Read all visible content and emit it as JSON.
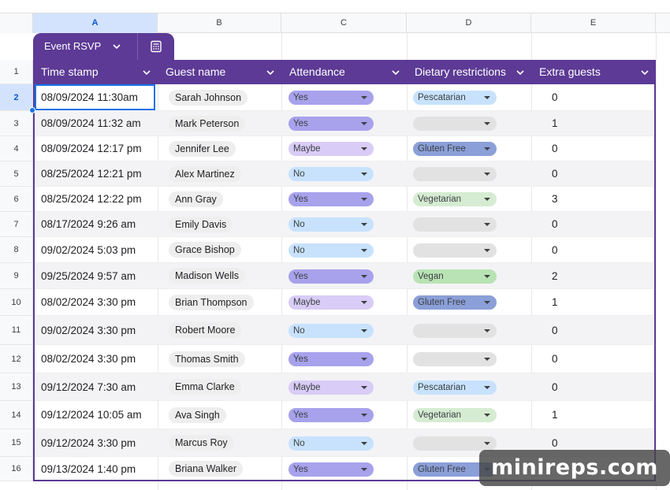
{
  "column_letters": [
    "A",
    "B",
    "C",
    "D",
    "E"
  ],
  "selected_column": "A",
  "table": {
    "name": "Event RSVP",
    "headers": [
      "Time stamp",
      "Guest name",
      "Attendance",
      "Dietary restrictions",
      "Extra guests"
    ]
  },
  "row_numbers": [
    "1",
    "2",
    "3",
    "4",
    "5",
    "6",
    "7",
    "8",
    "9",
    "10",
    "11",
    "12",
    "13",
    "14",
    "15",
    "16"
  ],
  "selected_row": "2",
  "colors": {
    "table_header": "#5c3a95",
    "yes": "#a8a2ec",
    "maybe": "#d9ccf6",
    "no": "#c8e2fd",
    "pescatarian": "#c8e2fd",
    "gluten_free": "#8b9fd8",
    "vegetarian": "#d6ecd2",
    "vegan": "#b9e3b4",
    "empty": "#e2e2e2"
  },
  "rows": [
    {
      "timestamp": "08/09/2024 11:30am",
      "guest": "Sarah Johnson",
      "attendance": "Yes",
      "dietary": "Pescatarian",
      "extra": "0"
    },
    {
      "timestamp": "08/09/2024 11:32 am",
      "guest": "Mark Peterson",
      "attendance": "Yes",
      "dietary": "",
      "extra": "1"
    },
    {
      "timestamp": "08/09/2024 12:17 pm",
      "guest": "Jennifer Lee",
      "attendance": "Maybe",
      "dietary": "Gluten Free",
      "extra": "0"
    },
    {
      "timestamp": "08/25/2024 12:21 pm",
      "guest": "Alex Martinez",
      "attendance": "No",
      "dietary": "",
      "extra": "0"
    },
    {
      "timestamp": "08/25/2024 12:22 pm",
      "guest": "Ann Gray",
      "attendance": "Yes",
      "dietary": "Vegetarian",
      "extra": "3"
    },
    {
      "timestamp": "08/17/2024 9:26 am",
      "guest": "Emily Davis",
      "attendance": "No",
      "dietary": "",
      "extra": "0"
    },
    {
      "timestamp": "09/02/2024 5:03 pm",
      "guest": "Grace Bishop",
      "attendance": "No",
      "dietary": "",
      "extra": "0"
    },
    {
      "timestamp": "09/25/2024 9:57 am",
      "guest": "Madison Wells",
      "attendance": "Yes",
      "dietary": "Vegan",
      "extra": "2"
    },
    {
      "timestamp": "08/02/2024 3:30 pm",
      "guest": "Brian Thompson",
      "attendance": "Maybe",
      "dietary": "Gluten Free",
      "extra": "1"
    },
    {
      "timestamp": "09/02/2024 3:30 pm",
      "guest": "Robert Moore",
      "attendance": "No",
      "dietary": "",
      "extra": "0"
    },
    {
      "timestamp": "08/02/2024 3:30 pm",
      "guest": "Thomas Smith",
      "attendance": "Yes",
      "dietary": "",
      "extra": "0"
    },
    {
      "timestamp": "09/12/2024 7:30 am",
      "guest": "Emma Clarke",
      "attendance": "Maybe",
      "dietary": "Pescatarian",
      "extra": "0"
    },
    {
      "timestamp": "09/12/2024 10:05 am",
      "guest": "Ava Singh",
      "attendance": "Yes",
      "dietary": "Vegetarian",
      "extra": "1"
    },
    {
      "timestamp": "09/12/2024 3:30 pm",
      "guest": "Marcus Roy",
      "attendance": "No",
      "dietary": "",
      "extra": "0"
    },
    {
      "timestamp": "09/13/2024 1:40 pm",
      "guest": "Briana Walker",
      "attendance": "Yes",
      "dietary": "Gluten Free",
      "extra": ""
    }
  ],
  "watermark": "minireps.com"
}
